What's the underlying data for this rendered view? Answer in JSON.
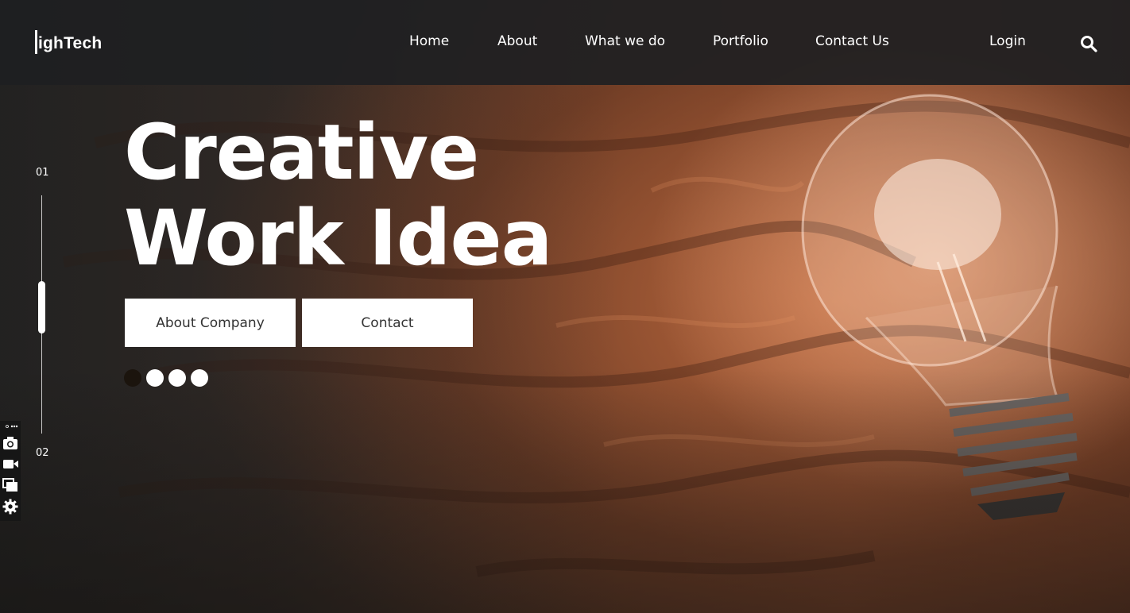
{
  "brand": {
    "logo_text": "ighTech"
  },
  "nav": {
    "items": [
      "Home",
      "About",
      "What we do",
      "Portfolio",
      "Contact Us"
    ],
    "login": "Login",
    "search_icon": "search-icon"
  },
  "slider": {
    "current": "01",
    "next": "02",
    "active_dot": 1,
    "dot_count": 4
  },
  "hero": {
    "line1": "Creative",
    "line2": "Work Idea",
    "primary_button": "About Company",
    "secondary_button": "Contact"
  },
  "toolbar": {
    "icons": [
      "more-icon",
      "camera-icon",
      "video-icon",
      "windows-icon",
      "gear-icon"
    ]
  },
  "colors": {
    "nav_bg": "#1e2022",
    "accent_dark": "#1b140d",
    "button_bg": "#ffffff"
  }
}
